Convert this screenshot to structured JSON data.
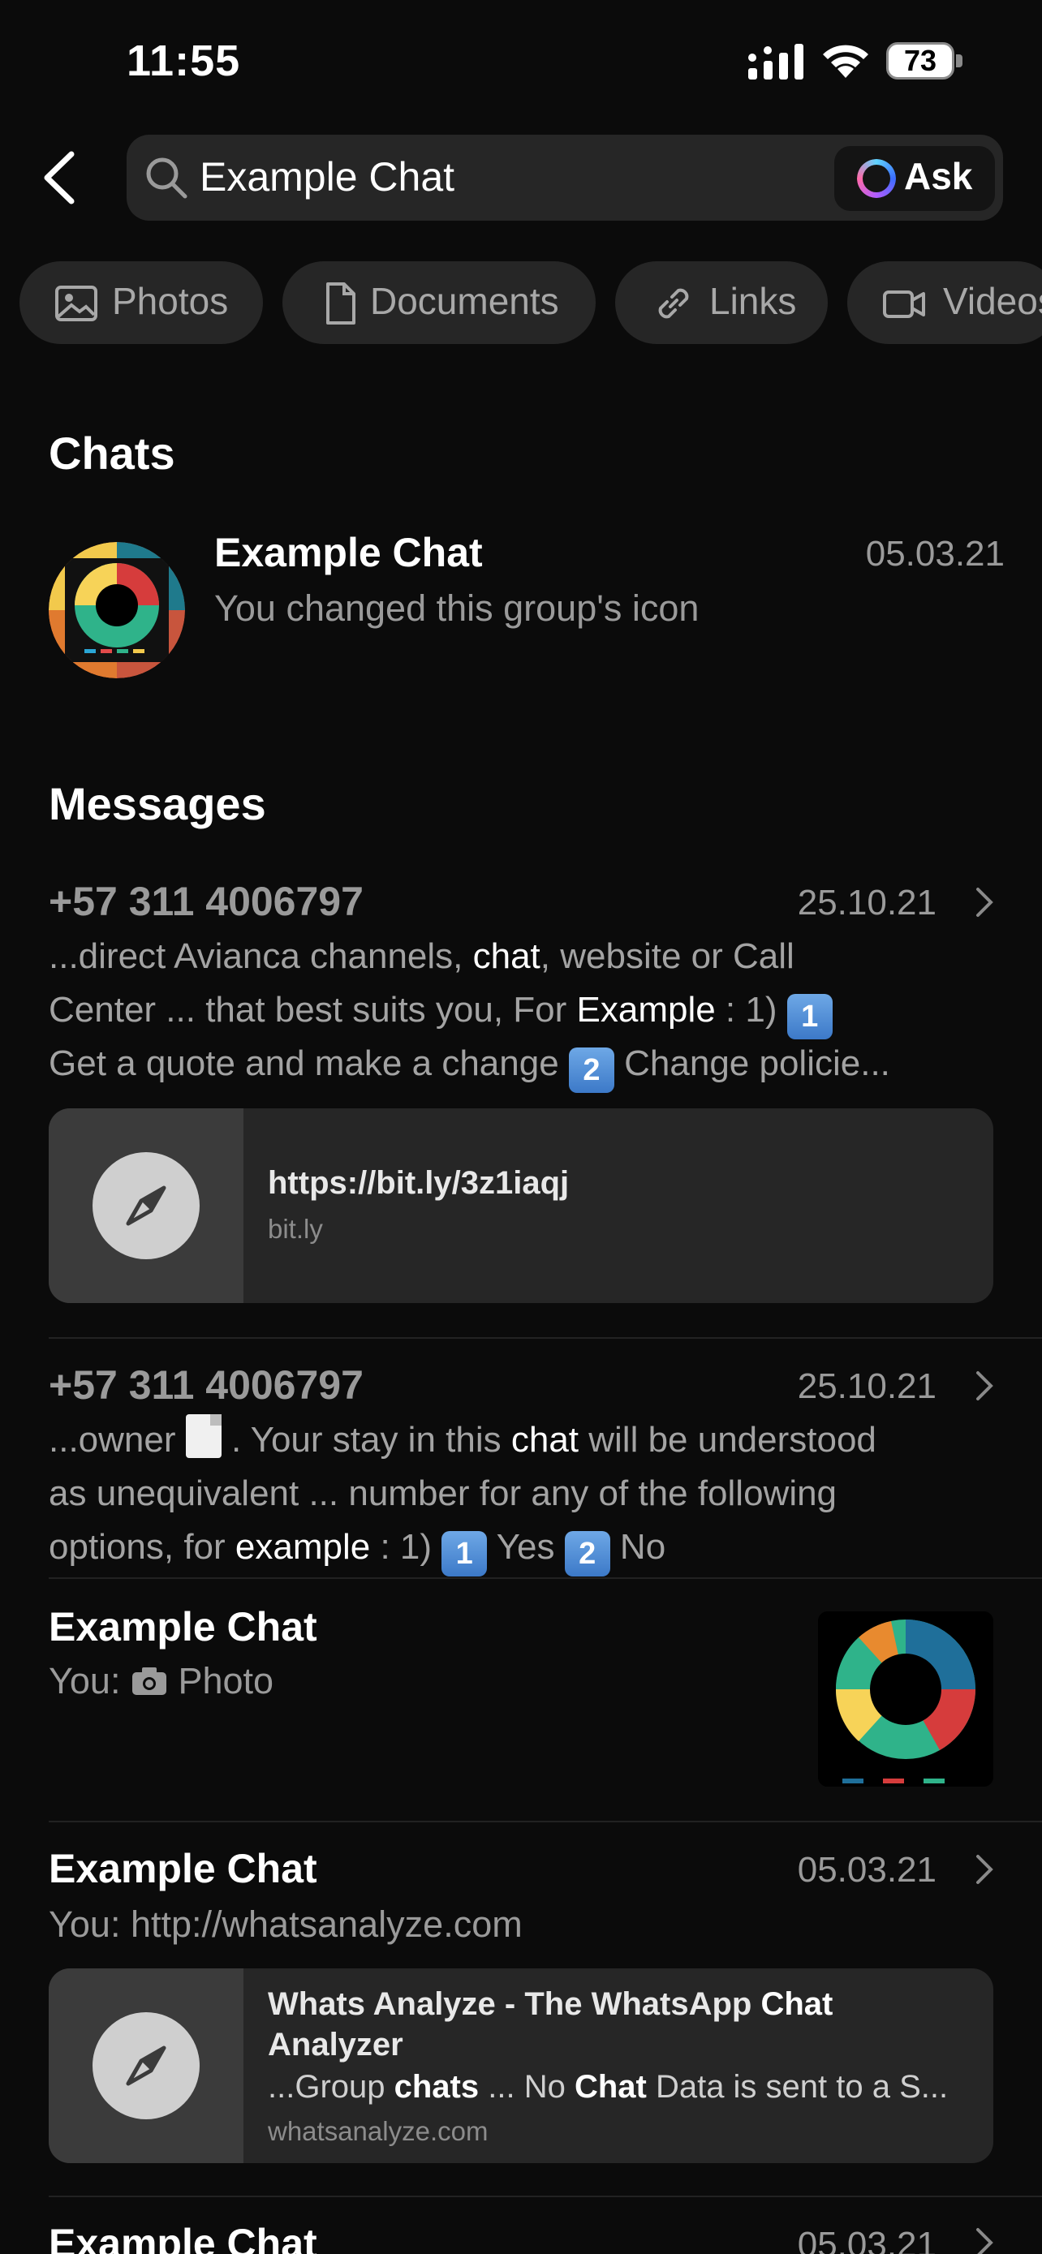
{
  "status_bar": {
    "time": "11:55",
    "battery": "73"
  },
  "search": {
    "query": "Example Chat",
    "ask_label": "Ask"
  },
  "filters": [
    {
      "label": "Photos",
      "icon": "photo-icon"
    },
    {
      "label": "Documents",
      "icon": "document-icon"
    },
    {
      "label": "Links",
      "icon": "link-icon"
    },
    {
      "label": "Videos",
      "icon": "video-icon"
    }
  ],
  "chats_section": {
    "title": "Chats",
    "items": [
      {
        "name": "Example Chat",
        "preview": "You changed this group's icon",
        "date": "05.03.21"
      }
    ]
  },
  "messages_section": {
    "title": "Messages",
    "items": [
      {
        "sender": "+57 311 4006797",
        "date": "25.10.21",
        "line1": [
          "...direct Avianca channels, ",
          "chat",
          ", website or Call"
        ],
        "line2": [
          "Center ... that best suits you, For ",
          "Example",
          " :  1) "
        ],
        "line2_key": "1",
        "line3": [
          "Get a quote and make a change ",
          "Change policie..."
        ],
        "line3_key": "2",
        "link": {
          "url": "https://bit.ly/3z1iaqj",
          "host": "bit.ly"
        }
      },
      {
        "sender": "+57 311 4006797",
        "date": "25.10.21",
        "line1": [
          "...owner ",
          " . Your stay in this ",
          "chat",
          " will be understood"
        ],
        "line2": "as unequivalent ... number for any of the following",
        "line3": [
          "options, for ",
          "example",
          " : 1) ",
          " Yes  ",
          " No"
        ],
        "line3_keys": [
          "1",
          "2"
        ]
      },
      {
        "name": "Example Chat",
        "you": "You:",
        "type_label": "Photo"
      },
      {
        "name": "Example Chat",
        "date": "05.03.21",
        "you": "You:",
        "text": "http://whatsanalyze.com",
        "link": {
          "title_parts": [
            "Whats Analyze - The WhatsApp ",
            "Chat"
          ],
          "title_line2": "Analyzer",
          "desc_parts": [
            "...Group ",
            "chats",
            " ... No ",
            "Chat",
            " Data is sent to a S..."
          ],
          "host": "whatsanalyze.com"
        }
      },
      {
        "name": "Example Chat",
        "date": "05.03.21"
      }
    ]
  },
  "colors": {
    "background": "#0b0b0b",
    "chip": "#262626",
    "muted_text": "#9a9a9a",
    "card": "#262626"
  }
}
